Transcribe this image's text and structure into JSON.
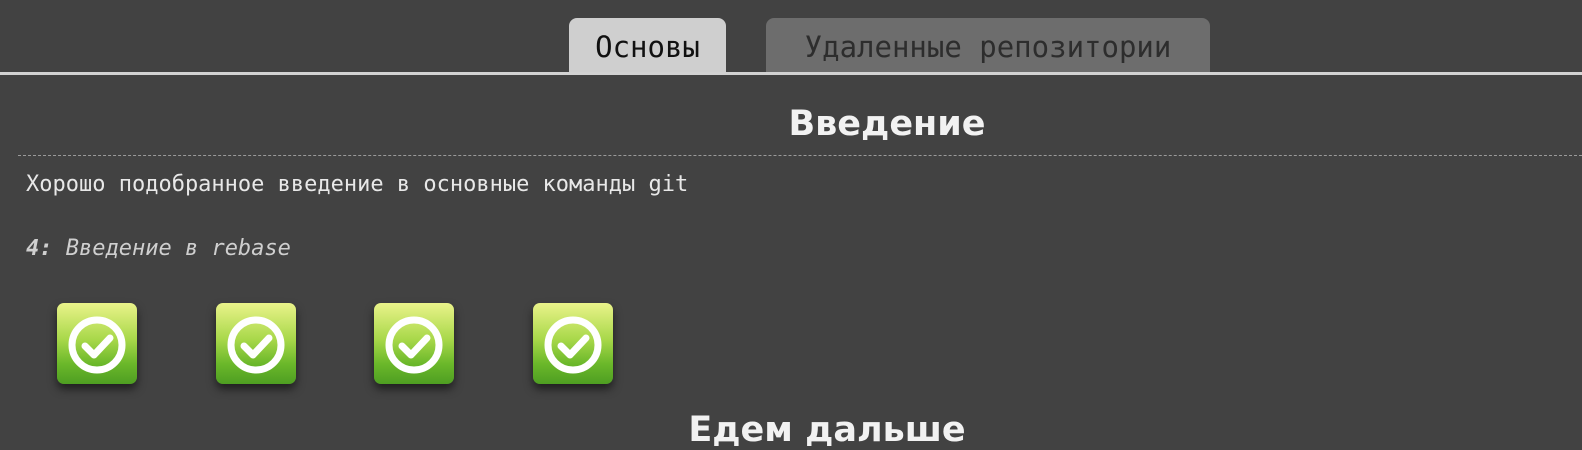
{
  "tabs": [
    {
      "label": "Основы",
      "active": true
    },
    {
      "label": "Удаленные репозитории",
      "active": false
    }
  ],
  "section": {
    "title": "Введение",
    "description": "Хорошо подобранное введение в основные команды git",
    "level_number": "4:",
    "level_name": "Введение в rebase",
    "levels": [
      {
        "status": "completed",
        "icon": "check-icon"
      },
      {
        "status": "completed",
        "icon": "check-icon"
      },
      {
        "status": "completed",
        "icon": "check-icon"
      },
      {
        "status": "completed",
        "icon": "check-icon"
      }
    ]
  },
  "next_section": {
    "title": "Едем дальше"
  },
  "colors": {
    "background": "#424242",
    "tab_active": "#cfcfcf",
    "tab_inactive": "#6d6d6d",
    "badge_top": "#eaf38a",
    "badge_bottom": "#4e9e22"
  }
}
